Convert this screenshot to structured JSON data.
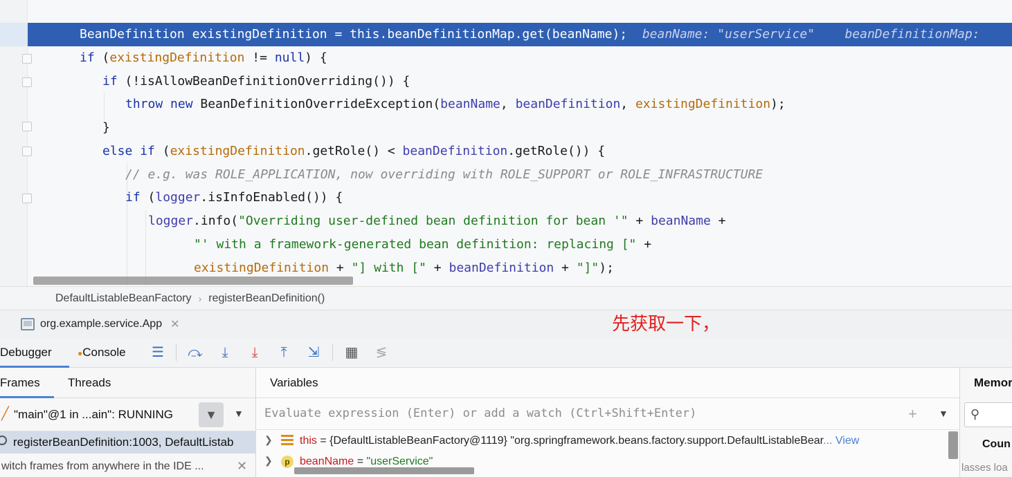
{
  "editor": {
    "lines": {
      "l1": {
        "kw1": "BeanDefinition",
        "var": "existingDefinition",
        "eq": " = ",
        "kw2": "this",
        "rest": ".beanDefinitionMap.get(beanName);",
        "hint1": "beanName: \"userService\"",
        "hint2": "beanDefinitionMap:"
      },
      "l2": {
        "kw": "if",
        "open": " (",
        "var": "existingDefinition",
        "mid": " != ",
        "kw2": "null",
        "close": ") {"
      },
      "l3": {
        "kw": "if",
        "rest": " (!isAllowBeanDefinitionOverriding()) {"
      },
      "l4": {
        "kw1": "throw",
        "kw2": "new",
        "cls": " BeanDefinitionOverrideException(",
        "p1": "beanName",
        "c1": ", ",
        "p2": "beanDefinition",
        "c2": ", ",
        "v1": "existingDefinition",
        "end": ");"
      },
      "l5": {
        "text": "}"
      },
      "l6": {
        "kw1": "else",
        "kw2": "if",
        "open": " (",
        "v1": "existingDefinition",
        "m1": ".getRole() < ",
        "p1": "beanDefinition",
        "m2": ".getRole()) {"
      },
      "l7": {
        "comment": "// e.g. was ROLE_APPLICATION, now overriding with ROLE_SUPPORT or ROLE_INFRASTRUCTURE"
      },
      "l8": {
        "kw": "if",
        "open": " (",
        "p1": "logger",
        "rest": ".isInfoEnabled()) {"
      },
      "l9": {
        "p1": "logger",
        "m1": ".info(",
        "s1": "\"Overriding user-defined bean definition for bean '\"",
        "m2": " + ",
        "p2": "beanName",
        "m3": " +"
      },
      "l10": {
        "s1": "\"' with a framework-generated bean definition: replacing [\"",
        "m1": " +"
      },
      "l11": {
        "v1": "existingDefinition",
        "m1": " + ",
        "s1": "\"] with [\"",
        "m2": " + ",
        "p1": "beanDefinition",
        "m3": " + ",
        "s2": "\"]\"",
        "end": ");"
      }
    }
  },
  "breadcrumb": {
    "class": "DefaultListableBeanFactory",
    "method": "registerBeanDefinition()"
  },
  "run_tab": {
    "label": "org.example.service.App",
    "close": "✕"
  },
  "annotation": "先获取一下，",
  "debugger": {
    "tabs": {
      "debugger": "Debugger",
      "console": "Console"
    }
  },
  "frames": {
    "tabs": {
      "frames": "Frames",
      "threads": "Threads"
    },
    "thread": "\"main\"@1 in ...ain\": RUNNING",
    "frame": "registerBeanDefinition:1003, DefaultListab",
    "hint": "witch frames from anywhere in the IDE ...",
    "hint_close": "✕"
  },
  "variables": {
    "title": "Variables",
    "eval_placeholder": "Evaluate expression (Enter) or add a watch (Ctrl+Shift+Enter)",
    "rows": [
      {
        "name": "this",
        "eq": " = ",
        "value": "{DefaultListableBeanFactory@1119} \"org.springframework.beans.factory.support.DefaultListableBear",
        "more": "... View"
      },
      {
        "name": "beanName",
        "eq": " = ",
        "value": "\"userService\""
      }
    ]
  },
  "memory": {
    "title": "Memor",
    "column": "Coun",
    "note": "lasses loa"
  },
  "colors": {
    "exec_line": "#2f5fb3",
    "keyword": "#1a33a8",
    "string": "#1f7a1f",
    "annotation": "#e21f1f",
    "accent": "#4a84d6"
  }
}
